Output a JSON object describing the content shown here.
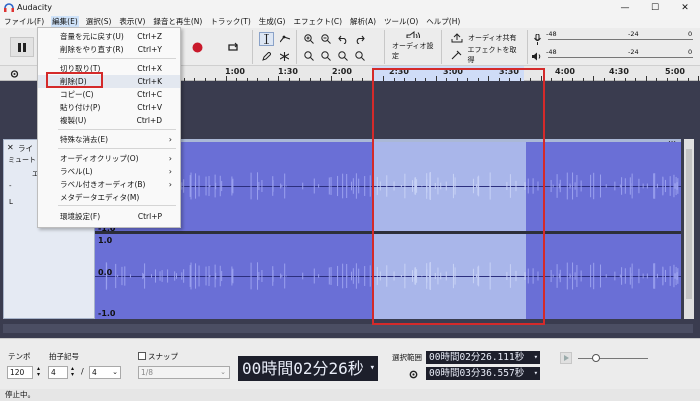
{
  "window": {
    "title": "Audacity",
    "minimize": "—",
    "maximize": "☐",
    "close": "✕"
  },
  "menubar": [
    "ファイル(F)",
    "編集(E)",
    "選択(S)",
    "表示(V)",
    "録音と再生(N)",
    "トラック(T)",
    "生成(G)",
    "エフェクト(C)",
    "解析(A)",
    "ツール(O)",
    "ヘルプ(H)"
  ],
  "toolbar": {
    "audio_setup": "オーディオ設定",
    "share_audio": "オーディオ共有",
    "get_effects": "エフェクトを取得",
    "meter_ticks": [
      "-48",
      "-24",
      "0"
    ]
  },
  "ruler": {
    "ticks": [
      "1:00",
      "1:30",
      "2:00",
      "2:30",
      "3:00",
      "3:30",
      "4:00",
      "4:30",
      "5:00"
    ],
    "minus_label": "-"
  },
  "track": {
    "close": "✕",
    "name": "ライ",
    "mute": "ミュート",
    "effects": "エ",
    "lr": "L",
    "amp_labels": [
      "1.0",
      "0.0",
      "-1.0",
      "1.0",
      "0.0",
      "-1.0"
    ],
    "menu_dots": "⋯"
  },
  "edit_menu": {
    "items": [
      {
        "label": "音量を元に戻す(U)",
        "shortcut": "Ctrl+Z"
      },
      {
        "label": "削除をやり直す(R)",
        "shortcut": "Ctrl+Y"
      },
      {
        "label": "切り取り(T)",
        "shortcut": "Ctrl+X"
      },
      {
        "label": "削除(D)",
        "shortcut": "Ctrl+K"
      },
      {
        "label": "コピー(C)",
        "shortcut": "Ctrl+C"
      },
      {
        "label": "貼り付け(P)",
        "shortcut": "Ctrl+V"
      },
      {
        "label": "複製(U)",
        "shortcut": "Ctrl+D"
      },
      {
        "label": "特殊な消去(E)",
        "shortcut": ""
      },
      {
        "label": "オーディオクリップ(O)",
        "shortcut": ""
      },
      {
        "label": "ラベル(L)",
        "shortcut": ""
      },
      {
        "label": "ラベル付きオーディオ(B)",
        "shortcut": ""
      },
      {
        "label": "メタデータエディタ(M)",
        "shortcut": ""
      },
      {
        "label": "環境設定(F)",
        "shortcut": "Ctrl+P"
      }
    ]
  },
  "bottom": {
    "tempo_label": "テンポ",
    "tempo_value": "120",
    "time_sig_label": "拍子記号",
    "time_sig_num": "4",
    "time_sig_slash": "/",
    "time_sig_den": "4",
    "snap_label": "スナップ",
    "snap_value": "1/8",
    "main_time": "00時間02分26秒",
    "selection_label": "選択範囲",
    "sel_start": "00時間02分26.111秒",
    "sel_end": "00時間03分36.557秒"
  },
  "status": "停止中。",
  "colors": {
    "waveform": "#6a6fd6",
    "selection": "#a9b6ea",
    "highlight": "#d42a2a",
    "track_bg": "#3a3c4f"
  }
}
